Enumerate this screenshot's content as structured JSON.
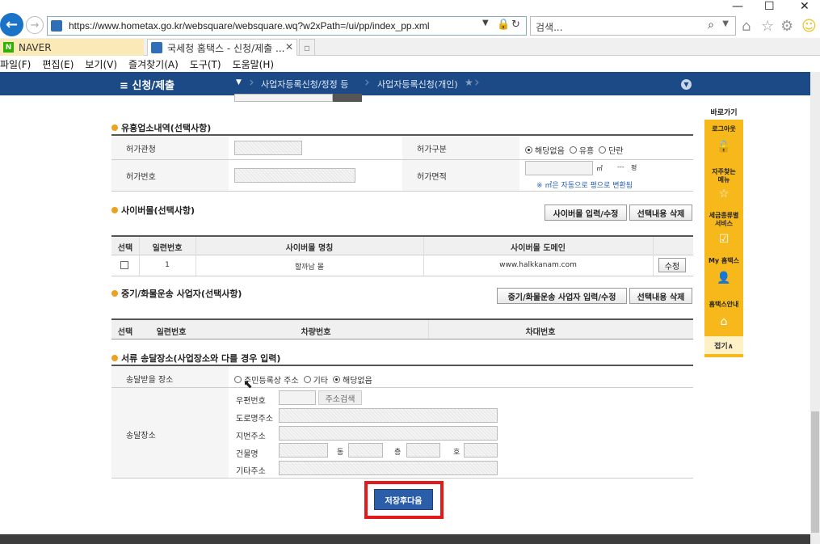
{
  "browser": {
    "url": "https://www.hometax.go.kr/websquare/websquare.wq?w2xPath=/ui/pp/index_pp.xml",
    "search_placeholder": "검색...",
    "tabs": [
      {
        "label": "NAVER"
      },
      {
        "label": "국세청 홈택스 - 신청/제출 ..."
      }
    ],
    "menu": [
      "파일(F)",
      "편집(E)",
      "보기(V)",
      "즐겨찾기(A)",
      "도구(T)",
      "도움말(H)"
    ]
  },
  "sitenav": {
    "title": "≡  신청/제출",
    "breadcrumbs": [
      "사업자등록신청/정정 등",
      "사업자등록신청(개인)"
    ]
  },
  "entertainment": {
    "title": "유흥업소내역(선택사항)",
    "permit_agency_label": "허가관청",
    "permit_type_label": "허가구분",
    "permit_type_options": [
      "해당없음",
      "유흥",
      "단란"
    ],
    "permit_type_selected": "해당없음",
    "permit_number_label": "허가번호",
    "permit_area_label": "허가면적",
    "area_unit": "㎡",
    "pyeong_value": "---",
    "pyeong_unit": "평",
    "area_note": "※ ㎡은 자동으로 평으로 변환됨"
  },
  "cybermall": {
    "title": "사이버몰(선택사항)",
    "input_button": "사이버몰 입력/수정",
    "delete_button": "선택내용 삭제",
    "headers": [
      "선택",
      "일련번호",
      "사이버몰 명칭",
      "사이버몰 도메인"
    ],
    "rows": [
      {
        "seq": "1",
        "name": "할까남 몰",
        "domain": "www.halkkanam.com",
        "edit": "수정"
      }
    ]
  },
  "vehicle": {
    "title": "중기/화물운송 사업자(선택사항)",
    "input_button": "중기/화물운송 사업자 입력/수정",
    "delete_button": "선택내용 삭제",
    "headers": [
      "선택",
      "일련번호",
      "차량번호",
      "차대번호"
    ]
  },
  "delivery": {
    "title": "서류 송달장소(사업장소와 다를 경우 입력)",
    "recipient_label": "송달받을 장소",
    "recipient_options": [
      "주민등록상 주소",
      "기타",
      "해당없음"
    ],
    "recipient_selected": "해당없음",
    "place_label": "송달장소",
    "postal_label": "우편번호",
    "address_search": "주소검색",
    "road_label": "도로명주소",
    "lot_label": "지번주소",
    "building_label": "건물명",
    "dong_label": "동",
    "floor_label": "층",
    "ho_label": "호",
    "other_label": "기타주소"
  },
  "quick_menu": {
    "title": "바로가기",
    "items": [
      "로그아웃",
      "자주찾는 메뉴",
      "세금종류별 서비스",
      "My 홈택스",
      "홈택스안내"
    ],
    "close": "접기∧"
  },
  "submit": {
    "save_next": "저장후다음"
  }
}
